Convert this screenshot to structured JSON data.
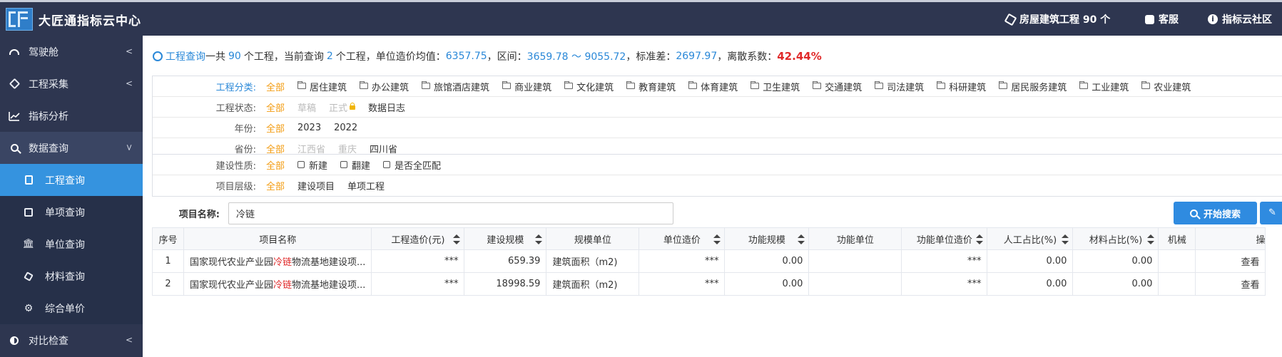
{
  "app": {
    "title": "大匠通指标云中心"
  },
  "topnav": {
    "project_type": "房屋建筑工程 90 个",
    "service": "客服",
    "community": "指标云社区"
  },
  "sidebar": {
    "items": [
      {
        "label": "驾驶舱",
        "icon": "gauge-icon"
      },
      {
        "label": "工程采集",
        "icon": "box-icon"
      },
      {
        "label": "指标分析",
        "icon": "chart-line-icon"
      },
      {
        "label": "数据查询",
        "icon": "search-icon"
      }
    ],
    "sub_items": [
      {
        "label": "工程查询",
        "icon": "document-icon"
      },
      {
        "label": "单项查询",
        "icon": "square-icon"
      },
      {
        "label": "单位查询",
        "icon": "bank-icon"
      },
      {
        "label": "材料查询",
        "icon": "cube-icon"
      },
      {
        "label": "综合单价",
        "icon": "gears-icon"
      }
    ],
    "bottom_item": {
      "label": "对比检查",
      "icon": "half-circle-icon"
    }
  },
  "summary": {
    "title": "工程查询",
    "t1": "一共",
    "total": "90",
    "t2": "个工程，当前查询",
    "current": "2",
    "t3": "个工程，单位造价均值：",
    "mean": "6357.75",
    "t4": "，区间：",
    "range": "3659.78 ～ 9055.72",
    "t5": "，标准差：",
    "std": "2697.97",
    "t6": "，离散系数：",
    "cv": "42.44%"
  },
  "filters": {
    "category": {
      "label": "工程分类:",
      "all": "全部",
      "options": [
        "居住建筑",
        "办公建筑",
        "旅馆酒店建筑",
        "商业建筑",
        "文化建筑",
        "教育建筑",
        "体育建筑",
        "卫生建筑",
        "交通建筑",
        "司法建筑",
        "科研建筑",
        "居民服务建筑",
        "工业建筑",
        "农业建筑"
      ]
    },
    "status": {
      "label": "工程状态:",
      "all": "全部",
      "draft": "草稿",
      "formal": "正式",
      "log": "数据日志"
    },
    "year": {
      "label": "年份:",
      "all": "全部",
      "options": [
        "2023",
        "2022"
      ]
    },
    "province": {
      "label": "省份:",
      "all": "全部",
      "disabled": [
        "江西省",
        "重庆"
      ],
      "options": [
        "四川省"
      ]
    },
    "nature": {
      "label": "建设性质:",
      "all": "全部",
      "options": [
        "新建",
        "翻建",
        "是否全匹配"
      ]
    },
    "level": {
      "label": "项目层级:",
      "all": "全部",
      "options": [
        "建设项目",
        "单项工程"
      ]
    }
  },
  "search": {
    "label": "项目名称:",
    "value": "冷链",
    "button": "开始搜索"
  },
  "table": {
    "headers": [
      "序号",
      "项目名称",
      "工程造价(元)",
      "建设规模",
      "规模单位",
      "单位造价",
      "功能规模",
      "功能单位",
      "功能单位造价",
      "人工占比(%)",
      "材料占比(%)",
      "机械",
      "操"
    ],
    "rows": [
      {
        "no": "1",
        "name_pre": "国家现代农业产业园",
        "name_hl": "冷链",
        "name_post": "物流基地建设项...",
        "cost": "***",
        "scale": "659.39",
        "unit": "建筑面积（m2)",
        "unit_price": "***",
        "func_scale": "0.00",
        "func_unit": "",
        "func_price": "***",
        "labor": "0.00",
        "material": "0.00",
        "machine": "",
        "action": "查看"
      },
      {
        "no": "2",
        "name_pre": "国家现代农业产业园",
        "name_hl": "冷链",
        "name_post": "物流基地建设项...",
        "cost": "***",
        "scale": "18998.59",
        "unit": "建筑面积（m2)",
        "unit_price": "***",
        "func_scale": "0.00",
        "func_unit": "",
        "func_price": "***",
        "labor": "0.00",
        "material": "0.00",
        "machine": "",
        "action": "查看"
      }
    ]
  }
}
